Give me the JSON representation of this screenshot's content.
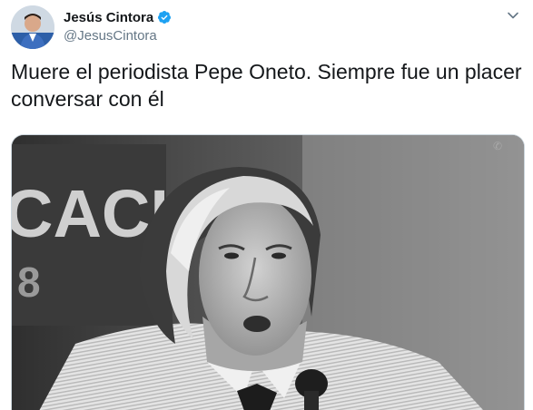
{
  "tweet": {
    "author": {
      "display_name": "Jesús Cintora",
      "handle": "@JesusCintora",
      "verified": true
    },
    "text": "Muere el periodista Pepe Oneto. Siempre fue un placer conversar con él",
    "media": {
      "kind": "photo",
      "description_colors": {
        "background": "#4a4a4a",
        "accent": "#e8e8e8"
      }
    }
  },
  "icons": {
    "verified": "verified-badge-icon",
    "more": "chevron-down-icon"
  },
  "colors": {
    "text": "#14171a",
    "secondary": "#657786",
    "verified": "#1da1f2",
    "border": "#ccd6dd"
  }
}
